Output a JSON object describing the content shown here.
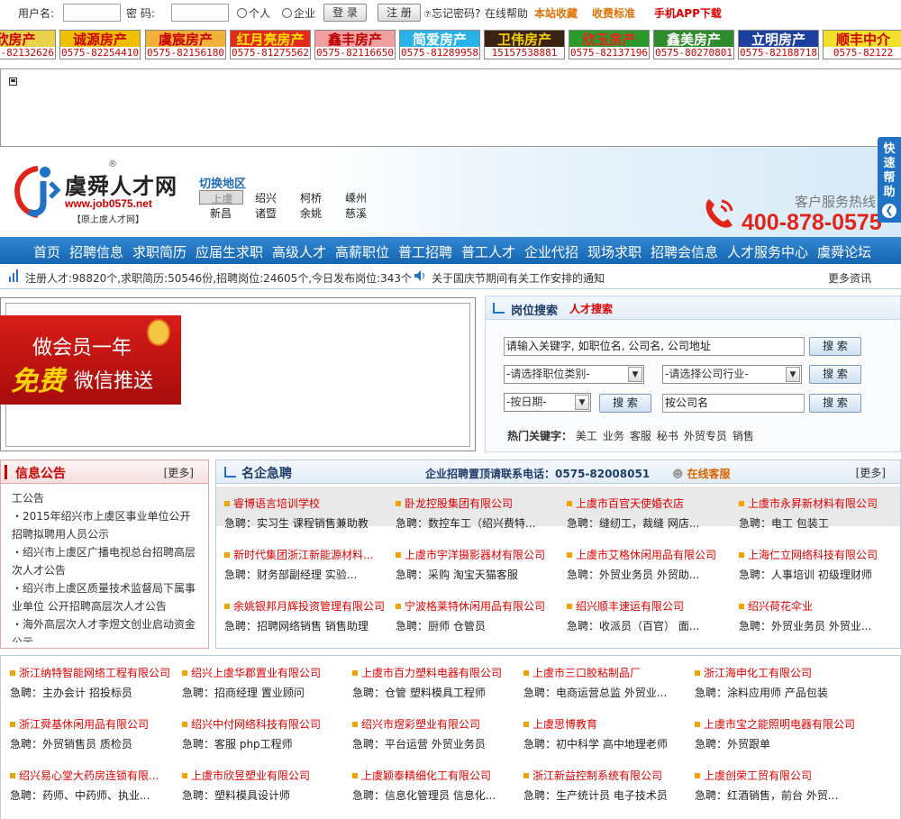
{
  "login": {
    "username_label": "用户名:",
    "password_label": "密  码:",
    "role_personal": "个人",
    "role_company": "企业",
    "login_button": "登 录",
    "register_button": "注 册",
    "forgot_password": "忘记密码?",
    "online_help": "在线帮助",
    "bookmark": "本站收藏",
    "pricing": "收费标准",
    "mobile_app": "手机APP下载"
  },
  "ads": [
    {
      "name": "欣房产",
      "phone": "0575-82132626",
      "bg": "#e8d34a",
      "color": "#c00"
    },
    {
      "name": "诚源房产",
      "phone": "0575-82254410",
      "bg": "#f0c000",
      "color": "#c00"
    },
    {
      "name": "虞宸房产",
      "phone": "0575-82156180",
      "bg": "#f3b13c",
      "color": "#c00"
    },
    {
      "name": "红月亮房产",
      "phone": "0575-81275562",
      "bg": "#e32b1d",
      "color": "#ffe200"
    },
    {
      "name": "鑫丰房产",
      "phone": "0575-82116650",
      "bg": "#f0a0a0",
      "color": "#b00"
    },
    {
      "name": "简爱房产",
      "phone": "0575-81289958",
      "bg": "#27b3ea",
      "color": "#fff"
    },
    {
      "name": "卫伟房产",
      "phone": "15157538881",
      "bg": "#3a2311",
      "color": "#f3d000"
    },
    {
      "name": "欣玉房产",
      "phone": "0575-82137196",
      "bg": "#2a9a2a",
      "color": "#e22"
    },
    {
      "name": "鑫美房产",
      "phone": "0575-80270801",
      "bg": "#2e8b2e",
      "color": "#fff"
    },
    {
      "name": "立明房产",
      "phone": "0575-82188718",
      "bg": "#1d3f9e",
      "color": "#fff"
    },
    {
      "name": "顺丰中介",
      "phone": "0575-82122",
      "bg": "#f2df2a",
      "color": "#c00"
    }
  ],
  "header": {
    "logo_cn": "虞舜人才网",
    "logo_reg": "®",
    "logo_url": "www.job0575.net",
    "logo_sub": "【原上虞人才网】",
    "switch_region": "切换地区",
    "regions_row1": [
      "上虞",
      "绍兴",
      "柯桥",
      "嵊州"
    ],
    "regions_row2": [
      "新昌",
      "诸暨",
      "余姚",
      "慈溪"
    ],
    "service_label": "客户服务热线",
    "service_number": "400-878-0575",
    "quick_help": "快速帮助"
  },
  "nav": [
    "首页",
    "招聘信息",
    "求职简历",
    "应届生求职",
    "高级人才",
    "高薪职位",
    "普工招聘",
    "普工人才",
    "企业代招",
    "现场求职",
    "招聘会信息",
    "人才服务中心",
    "虞舜论坛"
  ],
  "ticker": {
    "stats": "注册人才:98820个,求职简历:50546份,招聘岗位:24605个,今日发布岗位:343个",
    "news": "关于国庆节期间有关工作安排的通知",
    "more": "更多资讯"
  },
  "promo": {
    "line1": "做会员一年",
    "line2": "免费",
    "line3": "微信推送"
  },
  "search": {
    "tab_job": "岗位搜索",
    "tab_talent": "人才搜索",
    "keyword_placeholder": "请输入关键字, 如职位名, 公司名, 公司地址",
    "category_select": "-请选择职位类别-",
    "industry_select": "-请选择公司行业-",
    "date_select": "-按日期-",
    "company_input": "按公司名",
    "search_button": "搜 索",
    "hot_label": "热门关键字：",
    "hot_keywords": [
      "美工",
      "业务",
      "客服",
      "秘书",
      "外贸专员",
      "销售"
    ]
  },
  "notice": {
    "title": "信息公告",
    "more": "[更多]",
    "items": [
      "工公告",
      "・2015年绍兴市上虞区事业单位公开招聘拟聘用人员公示",
      "・绍兴市上虞区广播电视总台招聘高层次人才公告",
      "・绍兴市上虞区质量技术监督局下属事业单位 公开招聘高层次人才公告",
      "・海外高层次人才李煜文创业启动资金公示"
    ]
  },
  "famous": {
    "title": "名企急聘",
    "phone": "企业招聘置顶请联系电话：0575-82008051",
    "online_service": "在线客服",
    "more": "[更多]",
    "rec_label": "急聘：",
    "jobs": [
      {
        "company": "睿博语言培训学校",
        "positions": "实习生 课程销售兼助教"
      },
      {
        "company": "卧龙控股集团有限公司",
        "positions": "数控车工（绍兴费特..."
      },
      {
        "company": "上虞市百官天使婚衣店",
        "positions": "缝纫工，裁缝 网店..."
      },
      {
        "company": "上虞市永昇新材料有限公司",
        "positions": "电工 包装工"
      },
      {
        "company": "新时代集团浙江新能源材料...",
        "positions": "财务部副经理 实验..."
      },
      {
        "company": "上虞市宇洋摄影器材有限公司",
        "positions": "采购 淘宝天猫客服"
      },
      {
        "company": "上虞市艾格休闲用品有限公司",
        "positions": "外贸业务员 外贸助..."
      },
      {
        "company": "上海仁立网络科技有限公司",
        "positions": "人事培训 初级理财师"
      },
      {
        "company": "余姚银邦月辉投资管理有限公司",
        "positions": "招聘网络销售 销售助理"
      },
      {
        "company": "宁波格莱特休闲用品有限公司",
        "positions": "厨师 仓管员"
      },
      {
        "company": "绍兴顺丰速运有限公司",
        "positions": "收派员（百官） 面..."
      },
      {
        "company": "绍兴荷花伞业",
        "positions": "外贸业务员 外贸业..."
      }
    ]
  },
  "bottom_jobs": [
    {
      "company": "浙江纳特智能网络工程有限公司",
      "positions": "主办会计 招投标员"
    },
    {
      "company": "绍兴上虞华郡置业有限公司",
      "positions": "招商经理 置业顾问"
    },
    {
      "company": "上虞市百力塑料电器有限公司",
      "positions": "仓管 塑料模具工程师"
    },
    {
      "company": "上虞市三口胶粘制品厂",
      "positions": "电商运营总监 外贸业..."
    },
    {
      "company": "浙江海申化工有限公司",
      "positions": "涂料应用师 产品包装"
    },
    {
      "company": "浙江舜基休闲用品有限公司",
      "positions": "外贸销售员 质检员"
    },
    {
      "company": "绍兴中付网络科技有限公司",
      "positions": "客服 php工程师"
    },
    {
      "company": "绍兴市煜彩塑业有限公司",
      "positions": "平台运营 外贸业务员"
    },
    {
      "company": "上虞思博教育",
      "positions": "初中科学 高中地理老师"
    },
    {
      "company": "上虞市宝之能照明电器有限公司",
      "positions": "外贸跟单"
    },
    {
      "company": "绍兴易心堂大药房连锁有限...",
      "positions": "药师、中药师、执业..."
    },
    {
      "company": "上虞市欣昱塑业有限公司",
      "positions": "塑料模具设计师"
    },
    {
      "company": "上虞颖泰精细化工有限公司",
      "positions": "信息化管理员 信息化..."
    },
    {
      "company": "浙江新益控制系统有限公司",
      "positions": "生产统计员 电子技术员"
    },
    {
      "company": "上虞创荣工贸有限公司",
      "positions": "红酒销售，前台 外贸..."
    }
  ]
}
